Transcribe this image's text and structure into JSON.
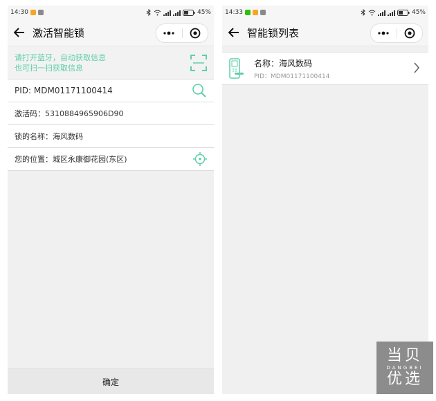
{
  "left": {
    "status": {
      "time": "14:30",
      "battery": "45%"
    },
    "title": "激活智能锁",
    "hint": {
      "line1": "请打开蓝牙，自动获取信息",
      "line2": "也可扫一扫获取信息"
    },
    "fields": [
      {
        "label": "PID: MDM01171100414"
      },
      {
        "label": "激活码：5310884965906D90"
      },
      {
        "label": "锁的名称：海风数码"
      },
      {
        "label": "您的位置：城区永康御花园(东区)"
      }
    ],
    "confirm_label": "确定"
  },
  "right": {
    "status": {
      "time": "14:33",
      "battery": "45%"
    },
    "title": "智能锁列表",
    "device": {
      "name": "名称：海风数码",
      "pid": "PID：MDM01171100414"
    }
  },
  "watermark": {
    "top": "当贝",
    "mid": "DANGBEI",
    "bottom": "优选"
  },
  "colors": {
    "accent": "#5ecfa7",
    "brand_gray": "#8c8c8c"
  }
}
